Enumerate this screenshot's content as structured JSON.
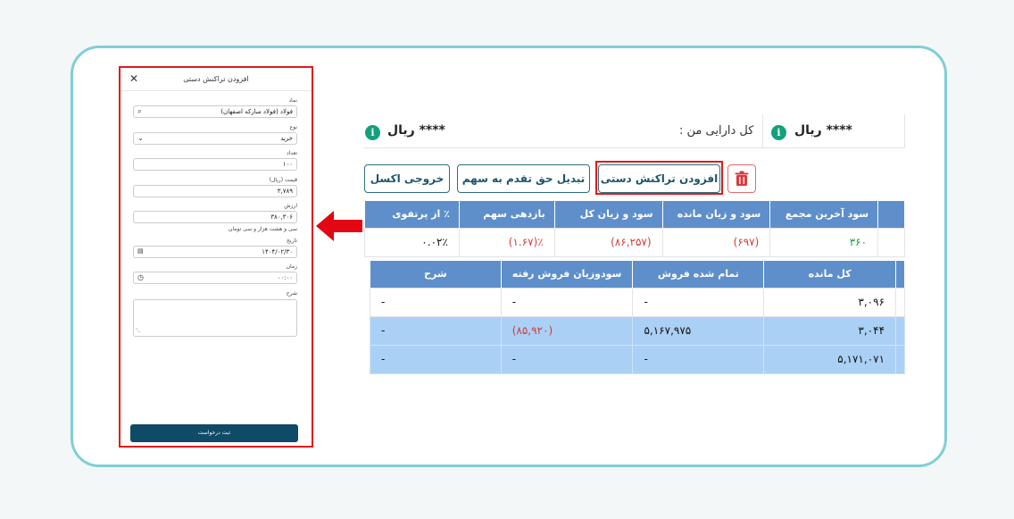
{
  "modal": {
    "title": "افزودن تراکنش دستی",
    "close_icon": "close-icon",
    "fields": {
      "symbol_label": "نماد",
      "symbol_value": "فولاد (فولاد مبارکه اصفهان)",
      "type_label": "نوع",
      "type_value": "خرید",
      "count_label": "تعداد",
      "count_value": "۱۰۰",
      "price_label": "قیمت (ریال)",
      "price_value": "۳,۷۸۹",
      "value_label": "ارزش",
      "value_value": "۳۸۰,۳۰۶",
      "value_words": "سی و هشت هزار و سی تومان",
      "date_label": "تاریخ",
      "date_value": "۱۴۰۴/۰۲/۳۰",
      "time_label": "زمان",
      "time_value": "۰۰:۰۰",
      "desc_label": "شرح"
    },
    "submit_label": "ثبت درخواست"
  },
  "summary": {
    "amount_right": "**** ریال",
    "total_label": "کل دارایی من :",
    "amount_left": "**** ریال"
  },
  "toolbar": {
    "add_manual": "افزودن تراکنش دستی",
    "convert_rights": "تبدیل حق تقدم به سهم",
    "excel_export": "خروجی اکسل"
  },
  "table1": {
    "headers": [
      "سود آخرین مجمع",
      "سود و زیان مانده",
      "سود و زیان کل",
      "بازدهی سهم",
      "٪ از پرتفوی"
    ],
    "row": [
      "۳۶۰",
      "(۶۹۷)",
      "(۸۶,۲۵۷)",
      "٪(۱.۶۷)",
      "۰.۰۲٪"
    ]
  },
  "table2": {
    "headers": [
      "کل مانده",
      "تمام شده فروش",
      "سودوزیان فروش رفته",
      "شرح"
    ],
    "rows": [
      [
        "۳,۰۹۶",
        "-",
        "-",
        "-"
      ],
      [
        "۳,۰۴۴",
        "۵,۱۶۷,۹۷۵",
        "(۸۵,۹۲۰)",
        "-"
      ],
      [
        "۵,۱۷۱,۰۷۱",
        "-",
        "-",
        "-"
      ]
    ]
  },
  "colors": {
    "header_blue": "#5e8fca",
    "accent": "#0f4a66",
    "highlight_red": "#e31919",
    "loss_red": "#d23b3b",
    "profit_green": "#1c9b49"
  }
}
